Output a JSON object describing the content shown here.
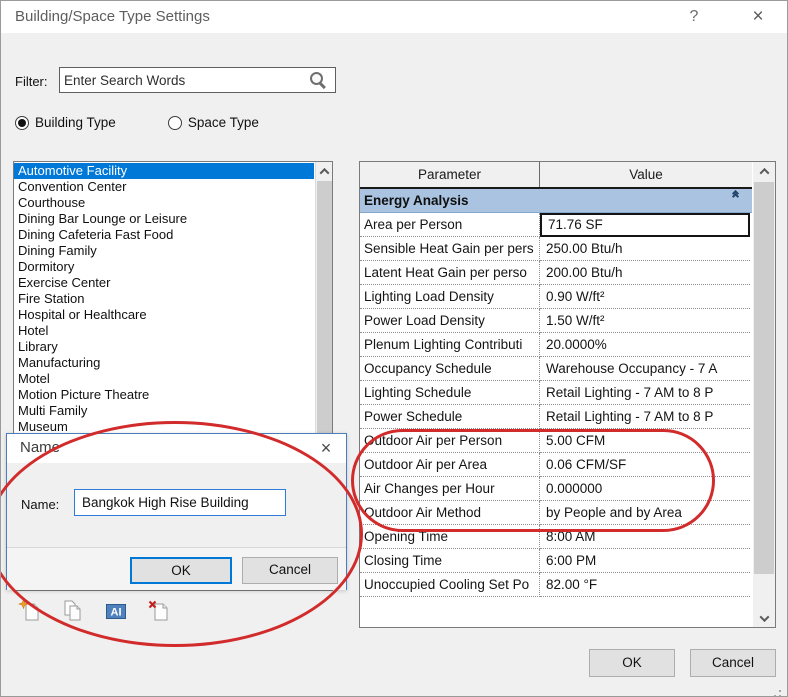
{
  "window": {
    "title": "Building/Space Type Settings",
    "help_label": "?",
    "close_label": "×"
  },
  "filter": {
    "label": "Filter:",
    "placeholder": "Enter Search Words"
  },
  "type_radios": [
    {
      "label": "Building Type",
      "selected": true
    },
    {
      "label": "Space Type",
      "selected": false
    }
  ],
  "building_type_list": [
    {
      "label": "Automotive Facility",
      "selected": true
    },
    {
      "label": "Convention Center"
    },
    {
      "label": "Courthouse"
    },
    {
      "label": "Dining Bar Lounge or Leisure"
    },
    {
      "label": "Dining Cafeteria Fast Food"
    },
    {
      "label": "Dining Family"
    },
    {
      "label": "Dormitory"
    },
    {
      "label": "Exercise Center"
    },
    {
      "label": "Fire Station"
    },
    {
      "label": "Hospital or Healthcare"
    },
    {
      "label": "Hotel"
    },
    {
      "label": "Library"
    },
    {
      "label": "Manufacturing"
    },
    {
      "label": "Motel"
    },
    {
      "label": "Motion Picture Theatre"
    },
    {
      "label": "Multi Family"
    },
    {
      "label": "Museum"
    }
  ],
  "parameter_table": {
    "columns": [
      "Parameter",
      "Value"
    ],
    "group_header": "Energy Analysis",
    "rows": [
      {
        "parameter": "Area per Person",
        "value": "71.76 SF",
        "editing": true
      },
      {
        "parameter": "Sensible Heat Gain per pers",
        "value": "250.00 Btu/h"
      },
      {
        "parameter": "Latent Heat Gain per perso",
        "value": "200.00 Btu/h"
      },
      {
        "parameter": "Lighting Load Density",
        "value": "0.90 W/ft²"
      },
      {
        "parameter": "Power Load Density",
        "value": "1.50 W/ft²"
      },
      {
        "parameter": "Plenum Lighting Contributi",
        "value": "20.0000%"
      },
      {
        "parameter": "Occupancy Schedule",
        "value": "Warehouse Occupancy - 7 A"
      },
      {
        "parameter": "Lighting Schedule",
        "value": "Retail Lighting - 7 AM to 8 P"
      },
      {
        "parameter": "Power Schedule",
        "value": "Retail Lighting - 7 AM to 8 P"
      },
      {
        "parameter": "Outdoor Air per Person",
        "value": "5.00 CFM",
        "highlighted": true
      },
      {
        "parameter": "Outdoor Air per Area",
        "value": "0.06 CFM/SF",
        "highlighted": true
      },
      {
        "parameter": "Air Changes per Hour",
        "value": "0.000000",
        "highlighted": true
      },
      {
        "parameter": "Outdoor Air Method",
        "value": "by People and by Area",
        "highlighted": true
      },
      {
        "parameter": "Opening Time",
        "value": "8:00 AM"
      },
      {
        "parameter": "Closing Time",
        "value": "6:00 PM"
      },
      {
        "parameter": "Unoccupied Cooling Set Po",
        "value": "82.00 °F"
      }
    ]
  },
  "name_dialog": {
    "title": "Name",
    "close_label": "×",
    "field_label": "Name:",
    "field_value": "Bangkok High Rise Building",
    "ok_label": "OK",
    "cancel_label": "Cancel"
  },
  "list_toolbar": {
    "icons": [
      "new-type-icon",
      "duplicate-type-icon",
      "rename-type-icon",
      "delete-type-icon"
    ]
  },
  "dialog_footer": {
    "ok_label": "OK",
    "cancel_label": "Cancel"
  },
  "annotations": {
    "color": "#d22b2b",
    "highlights": [
      "name-dialog-with-type-toolbar",
      "outdoor-air-parameter-rows"
    ]
  },
  "colors": {
    "accent": "#0078d7",
    "selection": "#0078d7",
    "group_header_bg": "#a9c3e0",
    "annotation_red": "#d22b2b"
  }
}
